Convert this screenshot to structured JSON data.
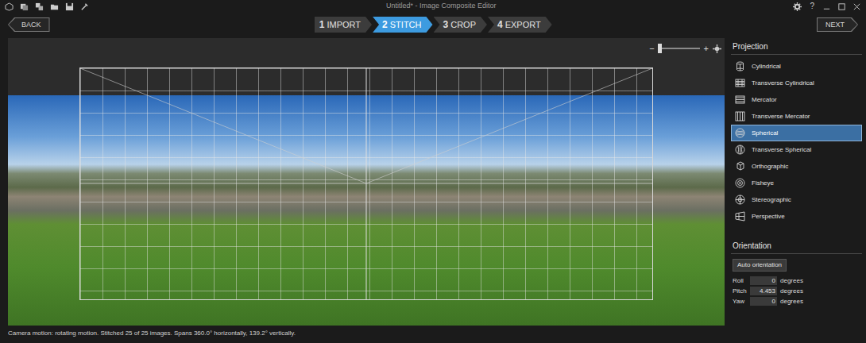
{
  "window": {
    "title": "Untitled* - Image Composite Editor",
    "help": "?"
  },
  "nav": {
    "back": "BACK",
    "next": "NEXT"
  },
  "steps": [
    {
      "number": "1",
      "label": "IMPORT",
      "selected": false
    },
    {
      "number": "2",
      "label": "STITCH",
      "selected": true
    },
    {
      "number": "3",
      "label": "CROP",
      "selected": false
    },
    {
      "number": "4",
      "label": "EXPORT",
      "selected": false
    }
  ],
  "zoom": {
    "minus": "−",
    "plus": "+",
    "level": 0.03
  },
  "projection": {
    "heading": "Projection",
    "items": [
      {
        "label": "Cylindrical",
        "selected": false
      },
      {
        "label": "Transverse Cylindrical",
        "selected": false
      },
      {
        "label": "Mercator",
        "selected": false
      },
      {
        "label": "Transverse Mercator",
        "selected": false
      },
      {
        "label": "Spherical",
        "selected": true
      },
      {
        "label": "Transverse Spherical",
        "selected": false
      },
      {
        "label": "Orthographic",
        "selected": false
      },
      {
        "label": "Fisheye",
        "selected": false
      },
      {
        "label": "Stereographic",
        "selected": false
      },
      {
        "label": "Perspective",
        "selected": false
      }
    ]
  },
  "orientation": {
    "heading": "Orientation",
    "auto_button": "Auto orientation",
    "fields": [
      {
        "label": "Roll",
        "value": "0",
        "unit": "degrees"
      },
      {
        "label": "Pitch",
        "value": "4.453",
        "unit": "degrees"
      },
      {
        "label": "Yaw",
        "value": "0",
        "unit": "degrees"
      }
    ]
  },
  "status_bar": "Camera motion: rotating motion. Stitched 25 of 25 images. Spans 360.0° horizontally, 139.2° vertically."
}
